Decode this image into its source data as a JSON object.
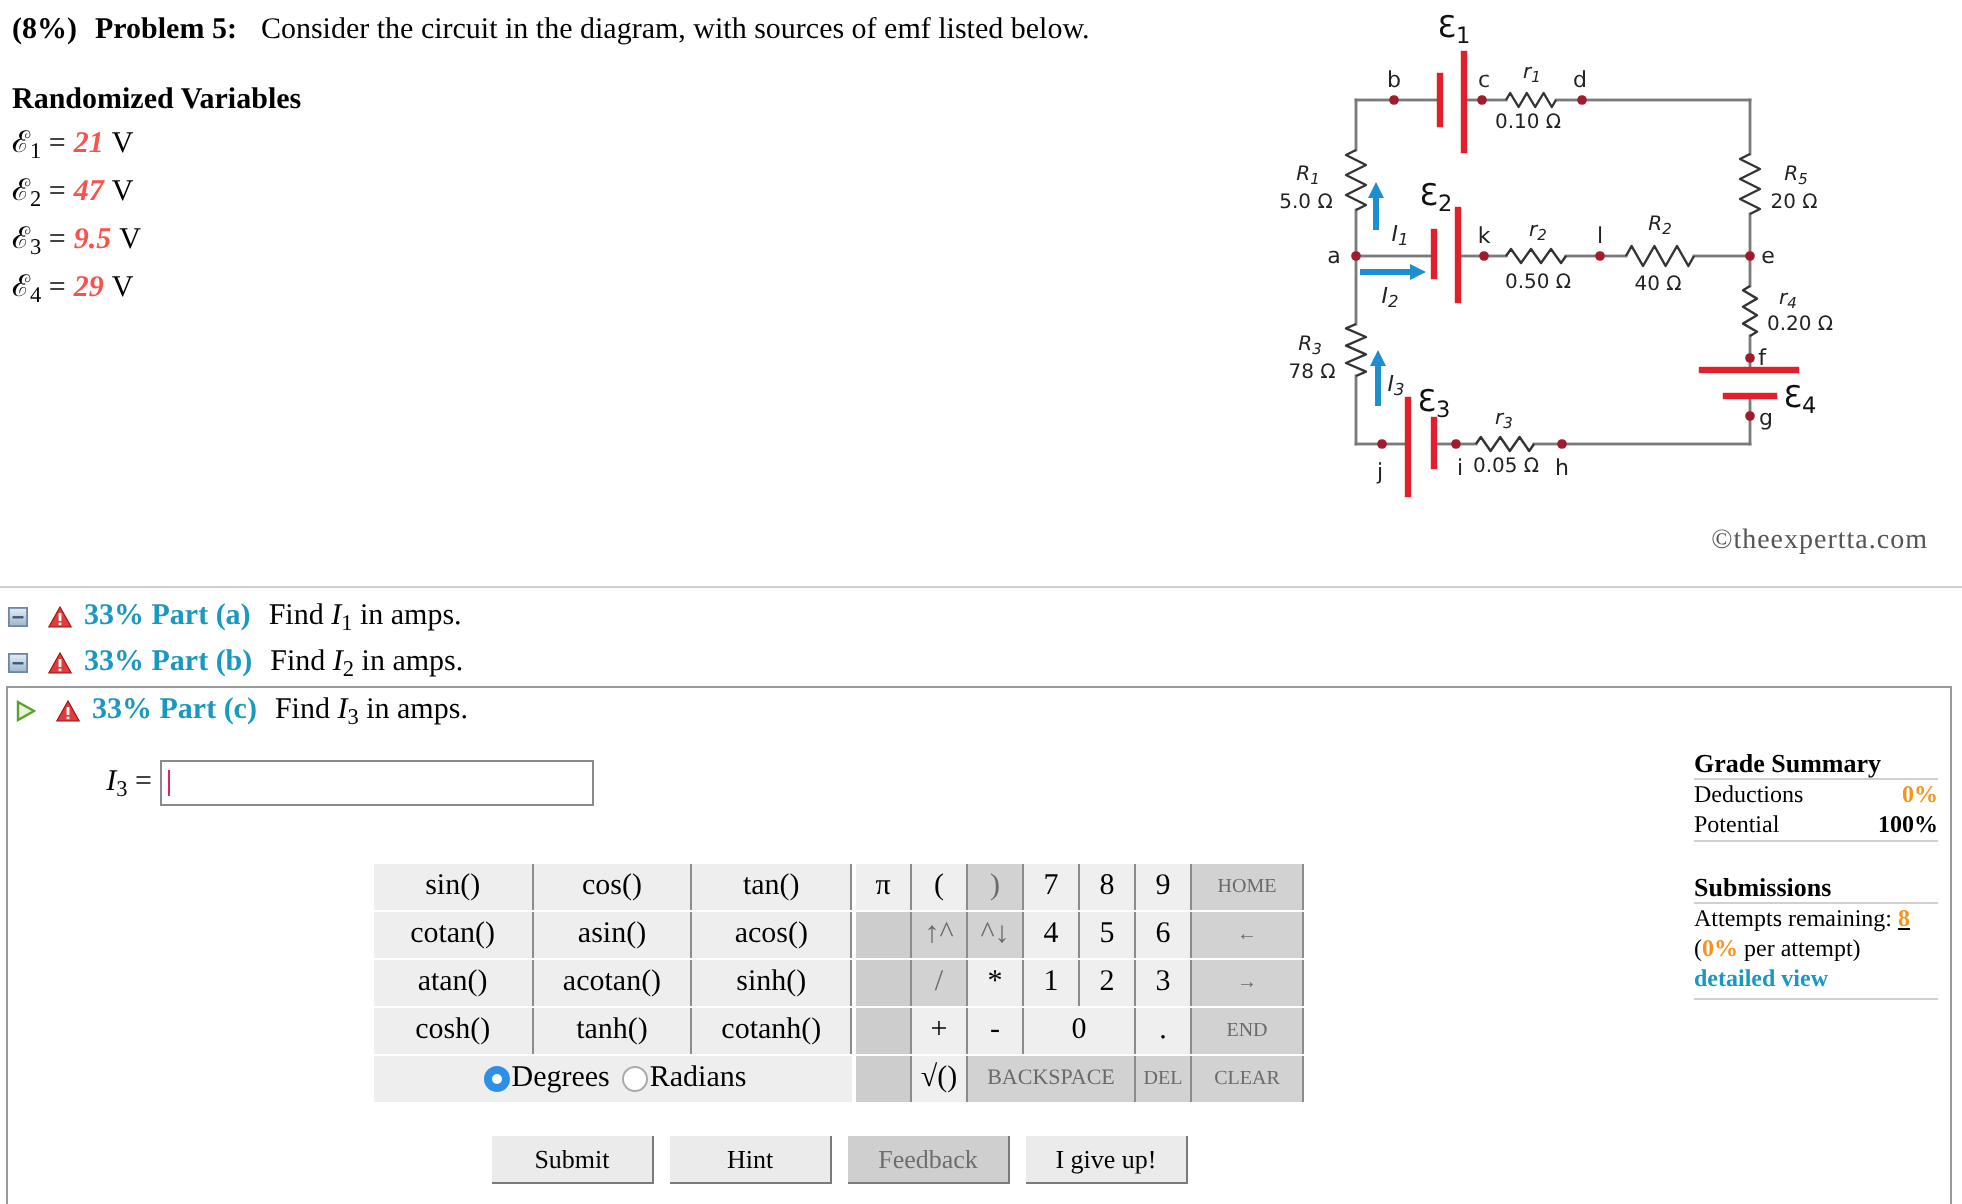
{
  "problem": {
    "weight": "(8%)",
    "title": "Problem 5:",
    "statement": "Consider the circuit in the diagram, with sources of emf listed below."
  },
  "variables": {
    "title": "Randomized Variables",
    "items": [
      {
        "symbol": "ℰ$_{1}$ =",
        "value": "21",
        "unit": "V"
      },
      {
        "symbol": "ℰ$_{2}$ =",
        "value": "47",
        "unit": "V"
      },
      {
        "symbol": "ℰ$_{3}$ =",
        "value": "9.5",
        "unit": "V"
      },
      {
        "symbol": "ℰ$_{4}$ =",
        "value": "29",
        "unit": "V"
      }
    ]
  },
  "circuit": {
    "emfs": [
      "Ɛ$_{1}$",
      "Ɛ$_{2}$",
      "Ɛ$_{3}$",
      "Ɛ$_{4}$"
    ],
    "resistors": [
      {
        "name": "r$_{1}$",
        "value": "0.10 Ω"
      },
      {
        "name": "R$_{1}$",
        "value": "5.0 Ω"
      },
      {
        "name": "R$_{5}$",
        "value": "20 Ω"
      },
      {
        "name": "r$_{2}$",
        "value": "0.50 Ω"
      },
      {
        "name": "R$_{2}$",
        "value": "40 Ω"
      },
      {
        "name": "r$_{4}$",
        "value": "0.20 Ω"
      },
      {
        "name": "R$_{3}$",
        "value": "78 Ω"
      },
      {
        "name": "r$_{3}$",
        "value": "0.05 Ω"
      }
    ],
    "nodes": [
      "b",
      "c",
      "d",
      "a",
      "k",
      "l",
      "e",
      "f",
      "g",
      "j",
      "i",
      "h"
    ],
    "currents": [
      "I$_{1}$",
      "I$_{2}$",
      "I$_{3}$"
    ]
  },
  "credit": "©theexpertta.com",
  "parts": [
    {
      "heading": "33% Part (a)",
      "prompt": "Find *I*$_{1}$ in amps.",
      "expanded": false
    },
    {
      "heading": "33% Part (b)",
      "prompt": "Find *I*$_{2}$ in amps.",
      "expanded": false
    },
    {
      "heading": "33% Part (c)",
      "prompt": "Find *I*$_{3}$ in amps.",
      "expanded": true
    }
  ],
  "answer": {
    "label": "*I*$_{3}$ =",
    "focused": true
  },
  "function_keys": [
    "sin()",
    "cos()",
    "tan()",
    "cotan()",
    "asin()",
    "acos()",
    "atan()",
    "acotan()",
    "sinh()",
    "cosh()",
    "tanh()",
    "cotanh()"
  ],
  "angle_modes": [
    {
      "label": "Degrees",
      "selected": true
    },
    {
      "label": "Radians",
      "selected": false
    }
  ],
  "keypad": [
    {
      "kind": "key",
      "label": "π",
      "disabled": false
    },
    {
      "kind": "key",
      "label": "(",
      "disabled": false
    },
    {
      "kind": "key",
      "label": ")",
      "disabled": true
    },
    {
      "kind": "key",
      "label": "7",
      "disabled": false
    },
    {
      "kind": "key",
      "label": "8",
      "disabled": false
    },
    {
      "kind": "key",
      "label": "9",
      "disabled": false
    },
    {
      "kind": "command",
      "label": "HOME",
      "disabled": true
    },
    {
      "kind": "blank"
    },
    {
      "kind": "key",
      "label": "↑^",
      "disabled": true
    },
    {
      "kind": "key",
      "label": "^↓",
      "disabled": true
    },
    {
      "kind": "key",
      "label": "4",
      "disabled": false
    },
    {
      "kind": "key",
      "label": "5",
      "disabled": false
    },
    {
      "kind": "key",
      "label": "6",
      "disabled": false
    },
    {
      "kind": "command",
      "label": "←",
      "disabled": true
    },
    {
      "kind": "blank"
    },
    {
      "kind": "key",
      "label": "/",
      "disabled": true
    },
    {
      "kind": "key",
      "label": "*",
      "disabled": false
    },
    {
      "kind": "key",
      "label": "1",
      "disabled": false
    },
    {
      "kind": "key",
      "label": "2",
      "disabled": false
    },
    {
      "kind": "key",
      "label": "3",
      "disabled": false
    },
    {
      "kind": "command",
      "label": "→",
      "disabled": true
    },
    {
      "kind": "blank"
    },
    {
      "kind": "key",
      "label": "+",
      "disabled": false
    },
    {
      "kind": "key",
      "label": "-",
      "disabled": false
    },
    {
      "kind": "double",
      "label": "0",
      "disabled": false
    },
    {
      "kind": "key",
      "label": ".",
      "disabled": false
    },
    {
      "kind": "command",
      "label": "END",
      "disabled": true
    },
    {
      "kind": "blank"
    },
    {
      "kind": "key",
      "label": "√()",
      "disabled": false
    },
    {
      "kind": "longcommand",
      "label": "BACKSPACE",
      "disabled": true
    },
    {
      "kind": "command",
      "label": "DEL",
      "disabled": true
    },
    {
      "kind": "command",
      "label": "CLEAR",
      "disabled": true
    }
  ],
  "grade_summary": {
    "title": "Grade Summary",
    "rows": [
      {
        "label": "Deductions",
        "value": "0%",
        "kind": "deduction"
      },
      {
        "label": "Potential",
        "value": "100%",
        "kind": "potential"
      }
    ]
  },
  "submissions": {
    "title": "Submissions",
    "attempts_label": "Attempts remaining:",
    "attempts": "8",
    "per_attempt": "(**0%** per attempt)",
    "link": "detailed view"
  },
  "buttons": [
    {
      "label": "Submit",
      "disabled": false
    },
    {
      "label": "Hint",
      "disabled": false
    },
    {
      "label": "Feedback",
      "disabled": true
    },
    {
      "label": "I give up!",
      "disabled": false
    }
  ]
}
